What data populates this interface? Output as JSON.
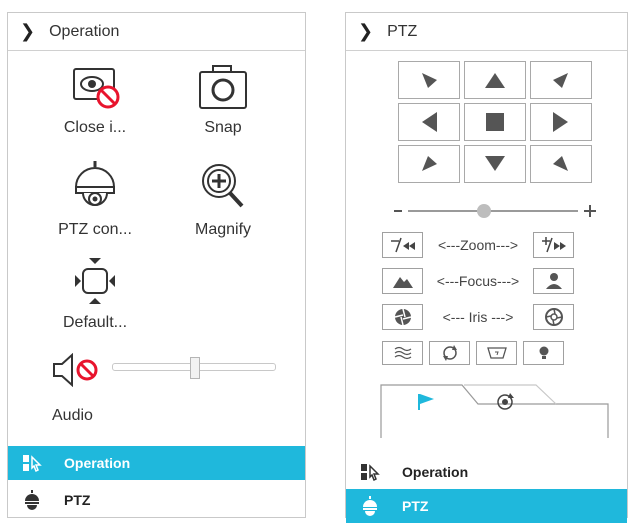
{
  "left_panel": {
    "header": {
      "title": "Operation"
    },
    "items": [
      {
        "label": "Close i...",
        "icon": "close-image-icon"
      },
      {
        "label": "Snap",
        "icon": "snap-camera-icon"
      },
      {
        "label": "PTZ con...",
        "icon": "ptz-dome-camera-icon"
      },
      {
        "label": "Magnify",
        "icon": "magnify-icon"
      },
      {
        "label": "Default...",
        "icon": "default-view-icon"
      }
    ],
    "audio": {
      "label": "Audio",
      "volume_fraction": 0.55,
      "muted": true
    },
    "tabs": [
      {
        "label": "Operation",
        "active": true
      },
      {
        "label": "PTZ",
        "active": false
      }
    ]
  },
  "right_panel": {
    "header": {
      "title": "PTZ"
    },
    "speed_fraction": 0.45,
    "zoom_label": "<---Zoom--->",
    "focus_label": "<---Focus--->",
    "iris_label": "<--- Iris --->",
    "tabs": [
      {
        "label": "Operation",
        "active": false
      },
      {
        "label": "PTZ",
        "active": true
      }
    ]
  },
  "colors": {
    "accent": "#1fb8dc",
    "alert_red": "#e8142d",
    "icon_dark": "#3a3a3a"
  }
}
